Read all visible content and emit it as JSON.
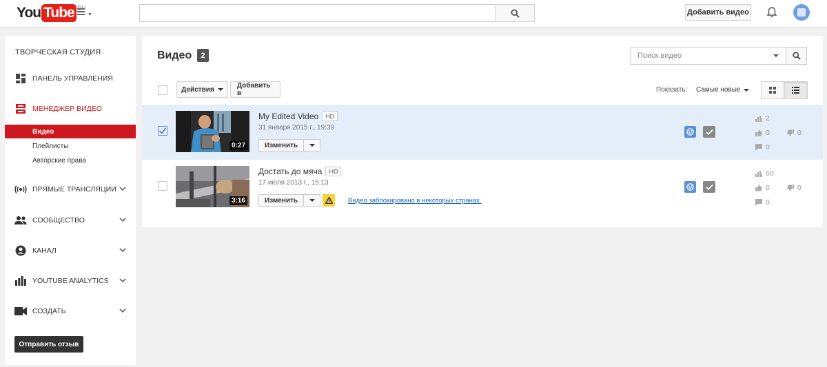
{
  "header": {
    "logo_you": "You",
    "logo_tube": "Tube",
    "logo_region": "RU",
    "search_value": "",
    "upload_label": "Добавить видео"
  },
  "sidebar": {
    "title": "ТВОРЧЕСКАЯ СТУДИЯ",
    "items": [
      {
        "label": "ПАНЕЛЬ УПРАВЛЕНИЯ",
        "icon": "dashboard-icon"
      },
      {
        "label": "МЕНЕДЖЕР ВИДЕО",
        "icon": "video-manager-icon",
        "active": true
      },
      {
        "label": "ПРЯМЫЕ ТРАНСЛЯЦИИ",
        "icon": "live-icon"
      },
      {
        "label": "СООБЩЕСТВО",
        "icon": "community-icon"
      },
      {
        "label": "КАНАЛ",
        "icon": "channel-icon"
      },
      {
        "label": "YOUTUBE ANALYTICS",
        "icon": "analytics-icon"
      },
      {
        "label": "СОЗДАТЬ",
        "icon": "create-icon"
      }
    ],
    "subitems": [
      {
        "label": "Видео",
        "selected": true
      },
      {
        "label": "Плейлисты"
      },
      {
        "label": "Авторские права"
      }
    ],
    "feedback_label": "Отправить отзыв"
  },
  "main": {
    "title": "Видео",
    "count": "2",
    "search_placeholder": "Поиск видео",
    "actions_label": "Действия",
    "add_to_label": "Добавить в",
    "show_label": "Показать:",
    "sort_value": "Самые новые",
    "videos": [
      {
        "title": "My Edited Video",
        "hd": "HD",
        "date": "31 января 2015 г., 19:39",
        "duration": "0:27",
        "edit_label": "Изменить",
        "checked": true,
        "views": "2",
        "likes": "0",
        "dislikes": "0",
        "comments": "0"
      },
      {
        "title": "Достать до мяча",
        "hd": "HD",
        "date": "17 июля 2013 г., 15:13",
        "duration": "3:16",
        "edit_label": "Изменить",
        "checked": false,
        "blocked_text": "Видео заблокировано в некоторых странах.",
        "views": "60",
        "likes": "0",
        "dislikes": "0",
        "comments": "0"
      }
    ]
  },
  "colors": {
    "brand_red": "#cc181e",
    "selected_row": "#e4eef8",
    "link_blue": "#1a66b8",
    "warning_yellow": "#f4d03f"
  }
}
